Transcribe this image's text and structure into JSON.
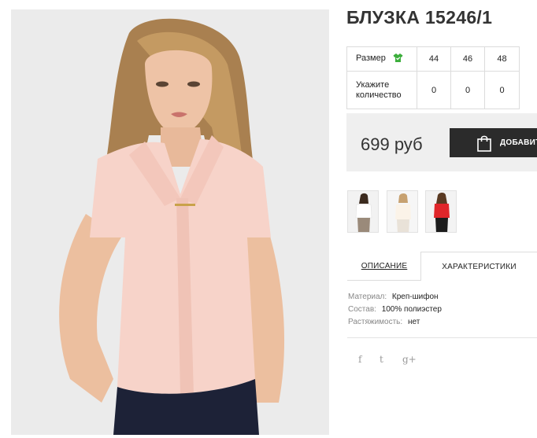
{
  "product": {
    "title": "БЛУЗКА 15246/1",
    "photo_alt": "Блузка 15246/1",
    "price": "699 руб",
    "buy_label": "ДОБАВИТЬ"
  },
  "size_table": {
    "size_label": "Размер",
    "qty_label_line1": "Укажите",
    "qty_label_line2": "количество",
    "sizes": [
      "44",
      "46",
      "48"
    ],
    "quantities": [
      "0",
      "0",
      "0"
    ]
  },
  "thumbnails": [
    {
      "name": "white-blouse"
    },
    {
      "name": "cream-blouse"
    },
    {
      "name": "red-blouse",
      "color": "#e0262a"
    }
  ],
  "tabs": {
    "description": "ОПИСАНИЕ",
    "characteristics": "ХАРАКТЕРИСТИКИ"
  },
  "specs": [
    {
      "key": "Материал:",
      "value": "Креп-шифон"
    },
    {
      "key": "Состав:",
      "value": "100% полиэстер"
    },
    {
      "key": "Растяжимость:",
      "value": "нет"
    }
  ],
  "social": {
    "facebook": "f",
    "twitter": "t",
    "google": "g+"
  },
  "colors": {
    "blouse": "#f7d3c9",
    "accent_green": "#3cae3c",
    "button_bg": "#2b2b2b",
    "price_bg": "#efefef"
  }
}
